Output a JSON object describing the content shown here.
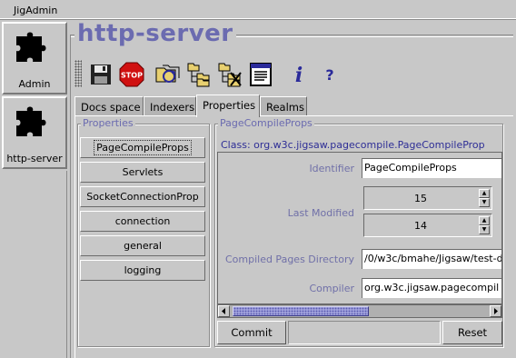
{
  "menubar": {
    "title": "JigAdmin"
  },
  "sidebar": {
    "items": [
      {
        "label": "Admin",
        "icon": "puzzle-icon"
      },
      {
        "label": "http-server",
        "icon": "puzzle-icon"
      }
    ]
  },
  "page": {
    "title": "http-server"
  },
  "toolbar": {
    "buttons": [
      {
        "name": "save",
        "icon": "floppy-disk-icon"
      },
      {
        "name": "stop",
        "icon": "stop-sign-icon",
        "text": "STOP"
      },
      {
        "name": "reload",
        "icon": "folder-reload-icon"
      },
      {
        "name": "add",
        "icon": "folder-tree-add-icon"
      },
      {
        "name": "delete",
        "icon": "folder-tree-delete-icon"
      },
      {
        "name": "document",
        "icon": "document-list-icon"
      },
      {
        "name": "info",
        "icon": "info-icon",
        "text": "i"
      },
      {
        "name": "help",
        "icon": "help-icon",
        "text": "?"
      }
    ]
  },
  "tabs": [
    {
      "label": "Docs space",
      "active": false
    },
    {
      "label": "Indexers",
      "active": false
    },
    {
      "label": "Properties",
      "active": true
    },
    {
      "label": "Realms",
      "active": false
    }
  ],
  "properties": {
    "title": "Properties",
    "items": [
      {
        "label": "PageCompileProps",
        "selected": true
      },
      {
        "label": "Servlets",
        "selected": false
      },
      {
        "label": "SocketConnectionProp",
        "selected": false
      },
      {
        "label": "connection",
        "selected": false
      },
      {
        "label": "general",
        "selected": false
      },
      {
        "label": "logging",
        "selected": false
      }
    ]
  },
  "editor": {
    "title": "PageCompileProps",
    "class_line": "Class: org.w3c.jigsaw.pagecompile.PageCompileProp",
    "identifier_label": "Identifier",
    "identifier_value": "PageCompileProps",
    "last_modified_label": "Last Modified",
    "last_modified_a": "15",
    "last_modified_b": "14",
    "compiled_dir_label": "Compiled Pages Directory",
    "compiled_dir_value": "/0/w3c/bmahe/Jigsaw/test-d",
    "compiler_label": "Compiler",
    "compiler_value": "org.w3c.jigsaw.pagecompil",
    "commit_label": "Commit",
    "reset_label": "Reset"
  },
  "colors": {
    "background": "#c8c8c8",
    "title": "#6b6bb0",
    "class_text": "#2e2e96",
    "field_label": "#7070a8",
    "scroll_thumb": "#9fa0dc"
  }
}
